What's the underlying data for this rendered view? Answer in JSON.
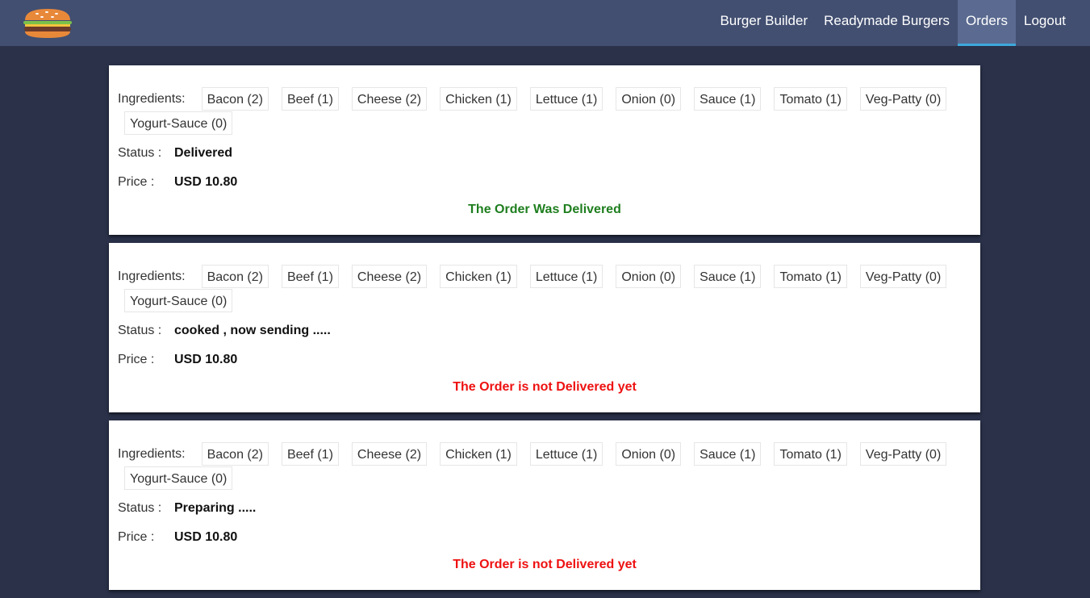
{
  "header": {
    "logo_icon": "burger-icon",
    "nav": [
      {
        "label": "Burger Builder",
        "active": false
      },
      {
        "label": "Readymade Burgers",
        "active": false
      },
      {
        "label": "Orders",
        "active": true
      },
      {
        "label": "Logout",
        "active": false
      }
    ]
  },
  "labels": {
    "ingredients": "Ingredients:",
    "status": "Status :",
    "price": "Price :"
  },
  "colors": {
    "background": "#2a3149",
    "header": "#424f71",
    "active_underline": "#3fa8dc",
    "delivered": "#1e7e1e",
    "not_delivered": "#ee1111"
  },
  "orders": [
    {
      "ingredients": [
        "Bacon (2)",
        "Beef (1)",
        "Cheese (2)",
        "Chicken (1)",
        "Lettuce (1)",
        "Onion (0)",
        "Sauce (1)",
        "Tomato (1)",
        "Veg-Patty (0)",
        "Yogurt-Sauce (0)"
      ],
      "status": "Delivered",
      "price": "USD 10.80",
      "message": "The Order Was Delivered",
      "delivered": true
    },
    {
      "ingredients": [
        "Bacon (2)",
        "Beef (1)",
        "Cheese (2)",
        "Chicken (1)",
        "Lettuce (1)",
        "Onion (0)",
        "Sauce (1)",
        "Tomato (1)",
        "Veg-Patty (0)",
        "Yogurt-Sauce (0)"
      ],
      "status": "cooked , now sending .....",
      "price": "USD 10.80",
      "message": "The Order is not Delivered yet",
      "delivered": false
    },
    {
      "ingredients": [
        "Bacon (2)",
        "Beef (1)",
        "Cheese (2)",
        "Chicken (1)",
        "Lettuce (1)",
        "Onion (0)",
        "Sauce (1)",
        "Tomato (1)",
        "Veg-Patty (0)",
        "Yogurt-Sauce (0)"
      ],
      "status": "Preparing .....",
      "price": "USD 10.80",
      "message": "The Order is not Delivered yet",
      "delivered": false
    }
  ]
}
